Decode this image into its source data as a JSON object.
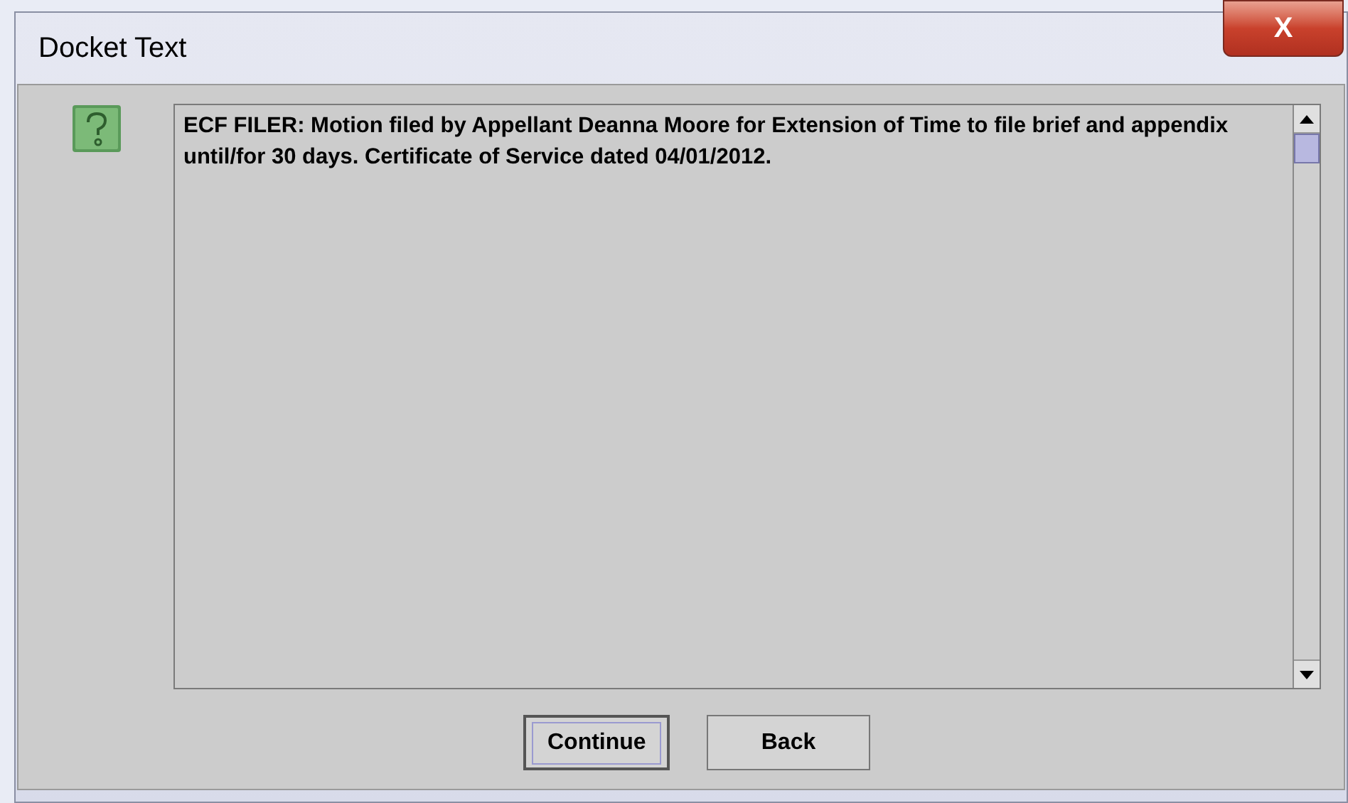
{
  "window": {
    "title": "Docket Text",
    "close": "X"
  },
  "message": "ECF FILER: Motion filed by Appellant Deanna Moore for Extension of Time to file brief and appendix until/for 30 days. Certificate of Service dated 04/01/2012.",
  "buttons": [
    {
      "label": "Continue",
      "focused": true
    },
    {
      "label": "Back",
      "focused": false
    }
  ]
}
